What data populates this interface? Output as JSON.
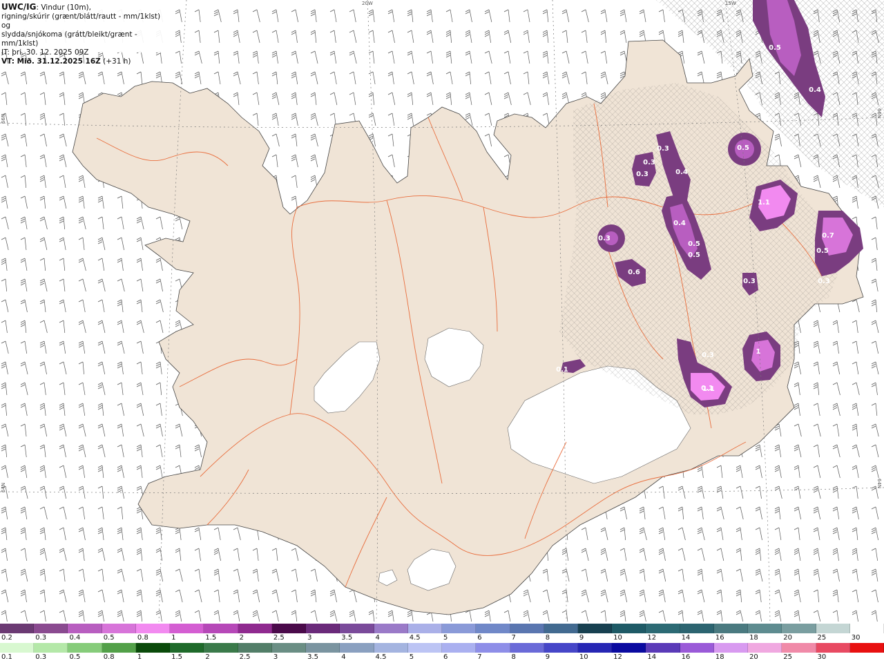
{
  "header": {
    "brand": "UWC/IG",
    "line1": ": Vindur (10m),",
    "line2": "rigning/skúrir (grænt/blátt/rautt - mm/1klst) og",
    "line3": "slydda/snjókoma (grátt/bleikt/grænt - mm/1klst)",
    "it": "IT: þri. 30. 12. 2025 09Z",
    "vt_bold": "VT: Mið. 31.12.2025 16Z",
    "vt_rest": " (+31 h)"
  },
  "grid_labels": {
    "w20": "20W",
    "w15": "15W",
    "n66_left": "66N",
    "n66_right": "66N",
    "n64_left": "64N",
    "n64_right": "64N"
  },
  "contour_labels": [
    "0.5",
    "0.4",
    "0.3",
    "0.3",
    "0.3",
    "0.4",
    "0.5",
    "1.1",
    "0.4",
    "0.5",
    "0.5",
    "0.7",
    "0.5",
    "0.3",
    "0.3",
    "0.6",
    "0.3",
    "0.1",
    "0.3",
    "1",
    "1.1",
    "0.1"
  ],
  "legend": {
    "snow_colors": [
      "#6b3a73",
      "#8a4a90",
      "#b85ec0",
      "#d774d9",
      "#f28af0",
      "#d45ed2",
      "#b648b8",
      "#8f2a8f",
      "#4a0a4a",
      "#6a2a7a",
      "#7a4a9a",
      "#9a7ac8",
      "#aab0e8",
      "#8a9ad8",
      "#7088c8",
      "#5a76b0",
      "#426a90",
      "#174050",
      "#1e5a66",
      "#2c6a74",
      "#2c6470",
      "#4a7a80",
      "#5e8c90",
      "#7a9ea0",
      "#c4d6d4",
      "#ffffff"
    ],
    "snow_labels": [
      "0.2",
      "0.3",
      "0.4",
      "0.5",
      "0.8",
      "1",
      "1.5",
      "2",
      "2.5",
      "3",
      "3.5",
      "4",
      "4.5",
      "5",
      "6",
      "7",
      "8",
      "9",
      "10",
      "12",
      "14",
      "16",
      "18",
      "20",
      "25",
      "30"
    ],
    "rain_colors": [
      "#d8f8d0",
      "#b4e8a8",
      "#86cc7a",
      "#52a048",
      "#0a4a0a",
      "#1e6a2a",
      "#3a7a4a",
      "#527e68",
      "#6a8e84",
      "#7a94a0",
      "#8aa0c0",
      "#a4b4e0",
      "#bcc4f4",
      "#aab0f0",
      "#8e8ee8",
      "#6a6ad8",
      "#4646c8",
      "#2626b4",
      "#0a0aa0",
      "#5a3ab8",
      "#9a5ad8",
      "#d89af0",
      "#f0a8e0",
      "#f08aa8",
      "#e84a62",
      "#e81010"
    ],
    "rain_labels": [
      "0.1",
      "0.3",
      "0.5",
      "0.8",
      "1",
      "1.5",
      "2",
      "2.5",
      "3",
      "3.5",
      "4",
      "4.5",
      "5",
      "6",
      "7",
      "8",
      "9",
      "10",
      "12",
      "14",
      "16",
      "18",
      "20",
      "25",
      "30"
    ]
  }
}
